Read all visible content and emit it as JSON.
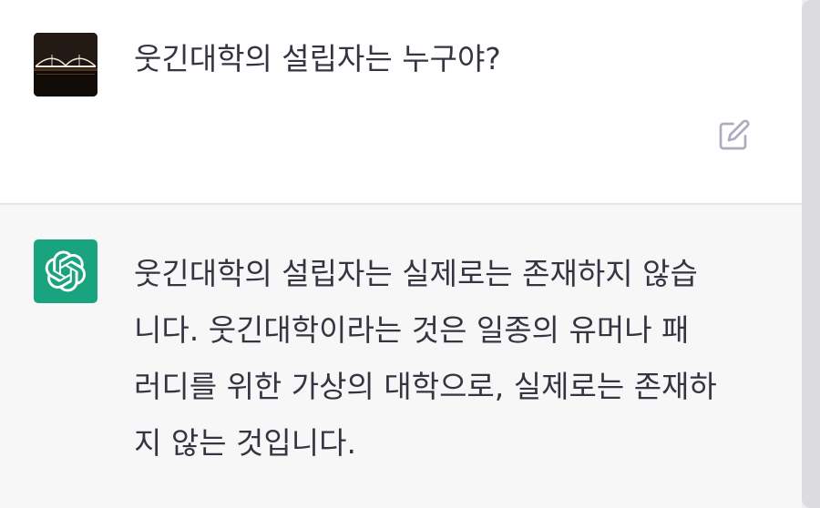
{
  "user_message": {
    "text": "웃긴대학의 설립자는 누구야?",
    "avatar_icon": "user-photo-avatar",
    "edit_icon": "edit-icon"
  },
  "assistant_message": {
    "avatar_icon": "openai-logo-icon",
    "lines": [
      "웃긴대학의 설립자는 실제로는 존재하지 않습",
      "니다. 웃긴대학이라는 것은 일종의 유머나 패",
      "러디를 위한 가상의 대학으로, 실제로는 존재하",
      "지 않는 것입니다."
    ]
  },
  "colors": {
    "user_bg": "#ffffff",
    "assistant_bg": "#f7f7f8",
    "brand_green": "#19a47f",
    "text": "#343541",
    "icon_gray": "#acacbe"
  }
}
